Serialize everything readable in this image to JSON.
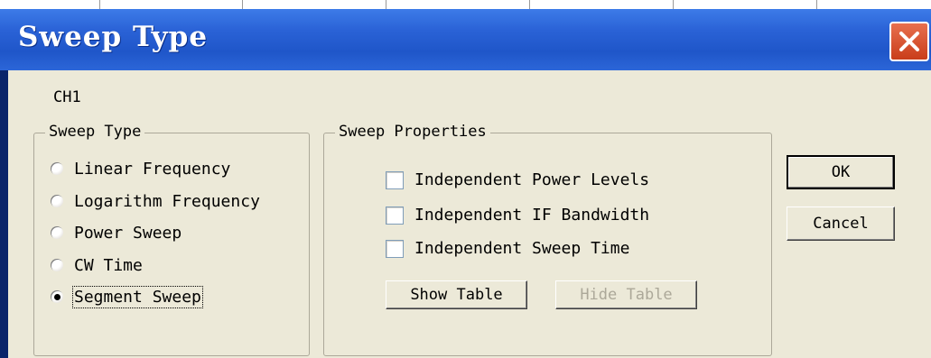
{
  "window": {
    "title": "Sweep Type",
    "close_icon": "close-icon"
  },
  "channel_label": "CH1",
  "sweep_type_group": {
    "title": "Sweep Type",
    "options": [
      {
        "label": "Linear Frequency",
        "selected": false
      },
      {
        "label": "Logarithm Frequency",
        "selected": false
      },
      {
        "label": "Power Sweep",
        "selected": false
      },
      {
        "label": "CW Time",
        "selected": false
      },
      {
        "label": "Segment Sweep",
        "selected": true
      }
    ]
  },
  "sweep_properties_group": {
    "title": "Sweep Properties",
    "checkboxes": [
      {
        "label": "Independent Power Levels",
        "checked": false
      },
      {
        "label": "Independent IF Bandwidth",
        "checked": false
      },
      {
        "label": "Independent Sweep Time",
        "checked": false
      }
    ],
    "show_table_label": "Show Table",
    "hide_table_label": "Hide Table"
  },
  "buttons": {
    "ok_label": "OK",
    "cancel_label": "Cancel"
  },
  "colors": {
    "titlebar": "#2a62d6",
    "client_bg": "#ece9d8",
    "close_button": "#d9542f"
  }
}
